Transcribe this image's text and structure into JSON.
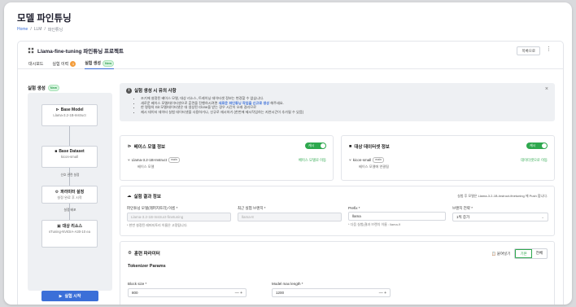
{
  "page": {
    "title": "모델 파인튜닝",
    "breadcrumb": [
      "Home",
      "/",
      "LLM",
      "/",
      "파인튜닝"
    ]
  },
  "project": {
    "title": "Llama-fine-tuning 파인튜닝 프로젝트",
    "list_button": "목록으로",
    "more": "⋮"
  },
  "tabs": [
    {
      "label": "대시보드"
    },
    {
      "label": "실험 이력",
      "count": "3"
    },
    {
      "label": "실험 생성",
      "badge": "New"
    }
  ],
  "sidebar": {
    "title": "실험 생성",
    "badge": "New",
    "nodes": [
      {
        "title": "Base Model",
        "sub": "Llama-3.2-1B-Instruct"
      },
      {
        "title": "Base Dataset",
        "sub": "kicon-small"
      },
      {
        "title": "파라미터 설정",
        "sub": "설정 완료 후 시작"
      },
      {
        "title": "대상 리소스",
        "sub": "sTuning-NVIDIA-A30-10 ea"
      }
    ],
    "edge_labels": [
      "선호 관련 설정",
      "설정 배포"
    ],
    "run_button": "실험 시작"
  },
  "notice": {
    "title": "실험 생성 시 유의 사항",
    "items": [
      "조기에 설정된 베이스 모델, 대상 리소스, 트레이닝 데이터셋 정보는 변경할 수 없습니다.",
      "새로운 베이스 모델/데이터셋으로 훈련을 진행하시려면 ",
      "한 명령의 Git 모델/데이터셋은 대 생성된 Clone을 받는 경우 시간이 오래 걸리므로",
      "제시 데이터 데이터 실험 데이터셋을 사용하거나, 신규로 재시하기 (한번에 제시작업하는 지연시간이 추가될 수 있음)"
    ],
    "highlight": "새로운 파인튜닝 작업을 신규로 생성",
    "highlight_suffix": " 해주세요."
  },
  "base_model_panel": {
    "title": "베이스 모델 정보",
    "toggle": "캐시",
    "model": "Llama-3.2-1B-Instruct",
    "branch": "main",
    "sub": "베이스 모델",
    "link": "베이스 모델로 이동"
  },
  "dataset_panel": {
    "title": "대상 데이터셋 정보",
    "toggle": "캐시",
    "dataset": "kicon-small",
    "branch": "main",
    "sub": "베이스 모델에 연결됨",
    "link": "데이터셋으로 이동"
  },
  "result_panel": {
    "title": "실험 결과 정보",
    "notice": "실험 후 모델은 Llama-3.2-1B-Instruct-finetuning 에 Push 합니다.",
    "fields": [
      {
        "label": "파인튜닝 모델(레퍼지토리) 이름 *",
        "value": "Llama-3.2-1B-Instruct-finetuning"
      },
      {
        "label": "최근 실험 브랜치 *",
        "value": "llama-8"
      },
      {
        "label": "Prefix *",
        "value": "llama"
      },
      {
        "label": "브랜치 전략 *",
        "value": "1씩 증가"
      }
    ],
    "hint_left": "* 한번 설정된 레퍼지토리 이름은 고정됩니다.",
    "hint_right": "* 다음 실험(결과 브랜치 이름 : llama-9"
  },
  "training_panel": {
    "title": "훈련 파라미터",
    "copy": "붙여넣기",
    "seg": [
      "기본",
      "전체"
    ],
    "section": "Tokenizer Params",
    "block_label": "Block size *",
    "block_value": "800",
    "maxlen_label": "Model max length *",
    "maxlen_value": "1200"
  }
}
